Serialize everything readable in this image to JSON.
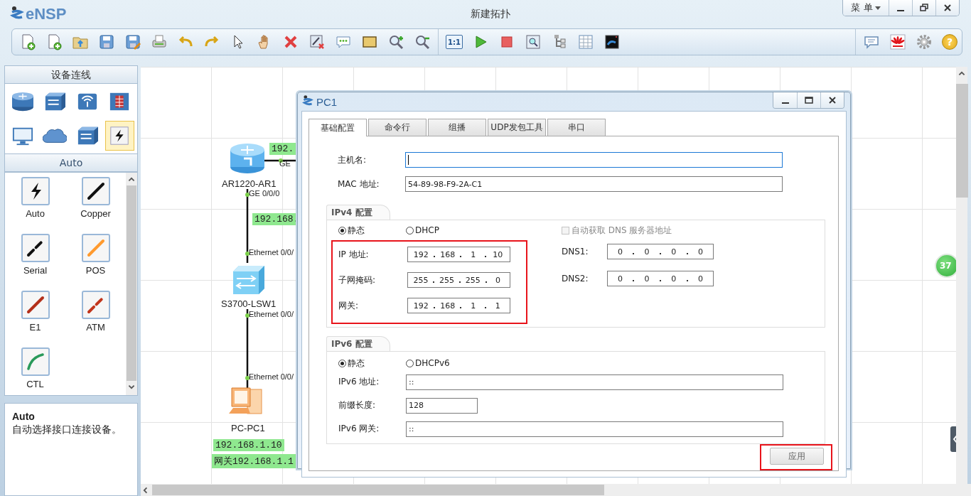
{
  "app": {
    "logo": "eNSP",
    "title": "新建拓扑",
    "menu": "菜 单"
  },
  "toolbar": {
    "zoom_reset": "1:1",
    "help": "?"
  },
  "device_panel": {
    "title": "设备连线",
    "categories": [
      {
        "selected": false
      },
      {
        "selected": false
      },
      {
        "selected": false
      },
      {
        "selected": false
      },
      {
        "selected": false
      },
      {
        "selected": false
      },
      {
        "selected": false
      },
      {
        "selected": true
      }
    ],
    "subtitle": "Auto",
    "cables": [
      {
        "label": "Auto",
        "kind": "auto",
        "color": "#111111"
      },
      {
        "label": "Copper",
        "kind": "solid",
        "color": "#111111"
      },
      {
        "label": "Serial",
        "kind": "dashed",
        "color": "#111111"
      },
      {
        "label": "POS",
        "kind": "solid",
        "color": "#ff9a2e"
      },
      {
        "label": "E1",
        "kind": "solid",
        "color": "#b3301a"
      },
      {
        "label": "ATM",
        "kind": "dashed",
        "color": "#c2361c"
      },
      {
        "label": "CTL",
        "kind": "curve",
        "color": "#2a9a5a"
      }
    ],
    "description": {
      "title": "Auto",
      "text": "自动选择接口连接设备。"
    }
  },
  "topology": {
    "nodes": [
      {
        "kind": "router",
        "name": "AR1220-AR1"
      },
      {
        "kind": "switch",
        "name": "S3700-LSW1"
      },
      {
        "kind": "pc",
        "name": "PC-PC1"
      }
    ],
    "labels": [
      {
        "kind": "ip",
        "text": "192."
      },
      {
        "kind": "port",
        "text": "GE"
      },
      {
        "kind": "port",
        "text": "GE 0/0/0"
      },
      {
        "kind": "ip",
        "text": "192.168."
      },
      {
        "kind": "port",
        "text": "Ethernet 0/0/"
      },
      {
        "kind": "port",
        "text": "Ethernet 0/0/"
      },
      {
        "kind": "port",
        "text": "Ethernet 0/0/"
      },
      {
        "kind": "ip",
        "text": "192.168.1.10"
      },
      {
        "kind": "ip",
        "text": "网关192.168.1.1"
      }
    ],
    "float_badge": "37"
  },
  "dialog": {
    "title": "PC1",
    "tabs": [
      {
        "label": "基础配置",
        "selected": true
      },
      {
        "label": "命令行",
        "selected": false
      },
      {
        "label": "组播",
        "selected": false
      },
      {
        "label": "UDP发包工具",
        "selected": false
      },
      {
        "label": "串口",
        "selected": false
      }
    ],
    "hostname": {
      "label": "主机名:",
      "focused": true
    },
    "mac": {
      "label": "MAC 地址:",
      "value": "54-89-98-F9-2A-C1"
    },
    "ipv4": {
      "legend": "IPv4 配置",
      "modes": [
        {
          "label": "静态",
          "selected": true
        },
        {
          "label": "DHCP",
          "selected": false
        }
      ],
      "dns_auto": {
        "label": "自动获取 DNS 服务器地址",
        "checked": false,
        "disabled": true
      },
      "highlighted": true,
      "fields": [
        {
          "label": "IP 地址:",
          "octets": [
            "192",
            "168",
            "1",
            "10"
          ]
        },
        {
          "label": "子网掩码:",
          "octets": [
            "255",
            "255",
            "255",
            "0"
          ]
        },
        {
          "label": "网关:",
          "octets": [
            "192",
            "168",
            "1",
            "1"
          ]
        }
      ],
      "dns": [
        {
          "label": "DNS1:",
          "octets": [
            "0",
            "0",
            "0",
            "0"
          ]
        },
        {
          "label": "DNS2:",
          "octets": [
            "0",
            "0",
            "0",
            "0"
          ]
        }
      ]
    },
    "ipv6": {
      "legend": "IPv6 配置",
      "modes": [
        {
          "label": "静态",
          "selected": true
        },
        {
          "label": "DHCPv6",
          "selected": false
        }
      ],
      "fields": [
        {
          "label": "IPv6 地址:",
          "value": "::",
          "kind": "wide"
        },
        {
          "label": "前缀长度:",
          "value": "128",
          "kind": "short"
        },
        {
          "label": "IPv6 网关:",
          "value": "::",
          "kind": "wide"
        }
      ]
    },
    "apply": {
      "label": "应用",
      "highlighted": true
    }
  }
}
